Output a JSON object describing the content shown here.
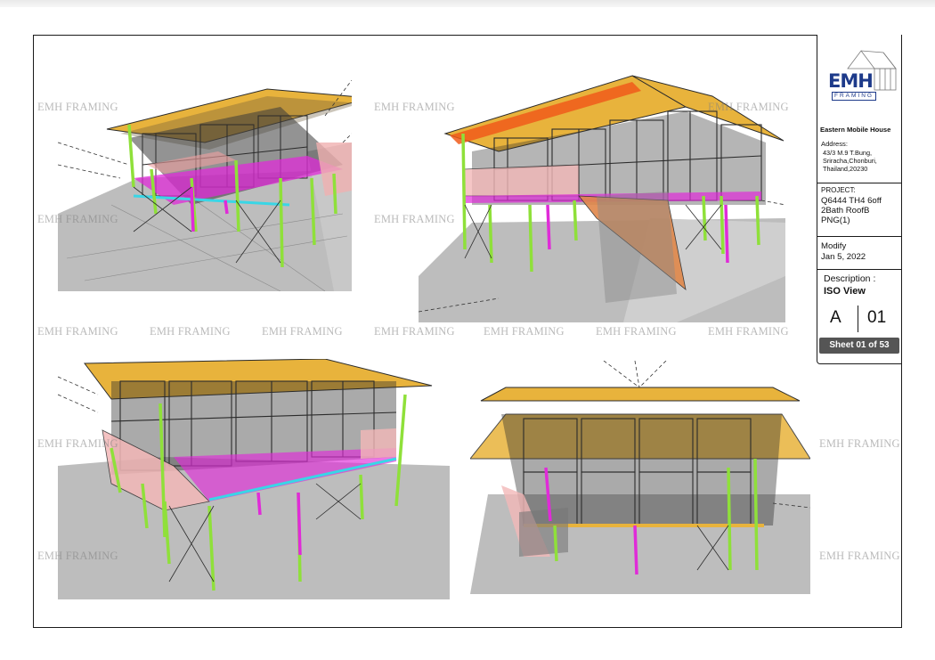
{
  "watermark_text": "EMH FRAMING",
  "title_block": {
    "logo_text": "EMH",
    "logo_subtext": "FRAMING",
    "company": "Eastern Mobile House",
    "address_label": "Address:",
    "address_lines": [
      "43/3 M.9 T.Bung,",
      "Sriracha,Chonburi,",
      "Thailand,20230"
    ],
    "project_label": "PROJECT:",
    "project_lines": [
      "Q6444 TH4 6off",
      "2Bath RoofB",
      "PNG(1)"
    ],
    "modify_label": "Modify",
    "modify_date": "Jan 5, 2022",
    "description_label": "Description :",
    "description": "ISO View",
    "revision": "A",
    "sheet_number": "01",
    "sheet_label": "Sheet 01 of 53"
  },
  "views": [
    {
      "id": "view-1"
    },
    {
      "id": "view-2"
    },
    {
      "id": "view-3"
    },
    {
      "id": "view-4"
    }
  ],
  "colors": {
    "columns": "#8fe03a",
    "purlins": "#e02bd8",
    "roof_edge": "#e8b33c",
    "frame": "#2b2b2b",
    "ground": "#bdbdbd",
    "stair": "#e0874a",
    "highlight": "#f05a1a",
    "cyan": "#39d6e6"
  }
}
